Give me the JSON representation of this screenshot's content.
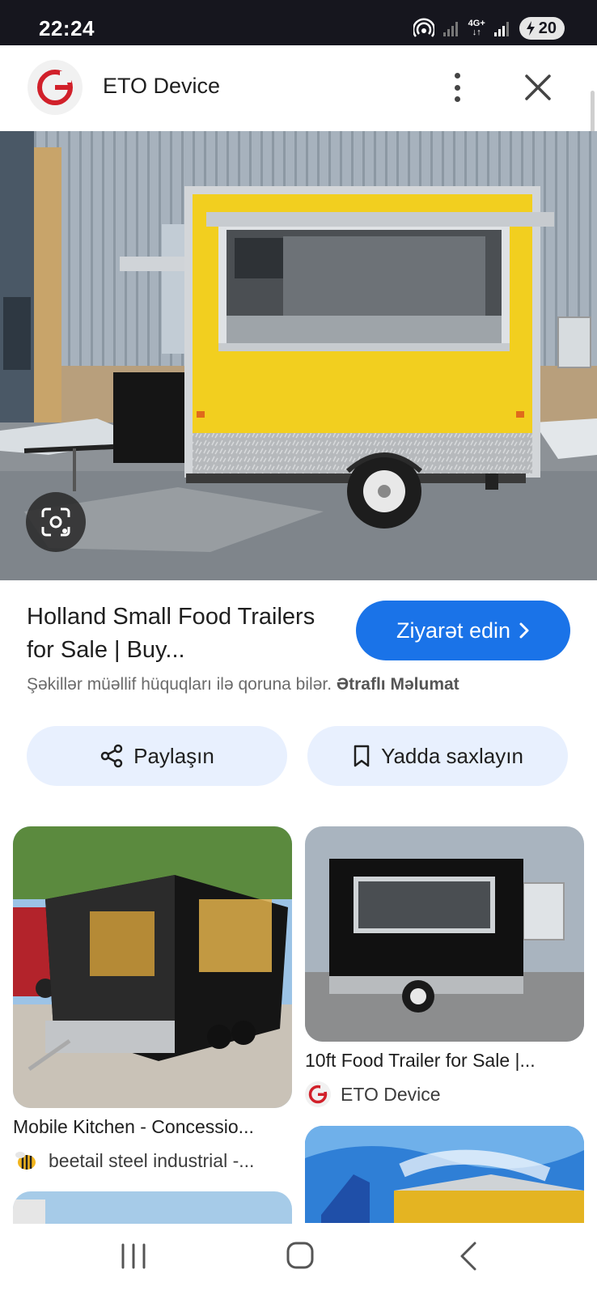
{
  "status_bar": {
    "time": "22:24",
    "network": "4G+",
    "battery": "20",
    "icons": [
      "hotspot-icon",
      "signal-icon",
      "signal-icon",
      "battery-icon"
    ]
  },
  "header": {
    "site_name": "ETO Device",
    "logo_letter": "G",
    "icons": [
      "more-options-icon",
      "close-icon"
    ]
  },
  "result": {
    "title": "Holland Small Food Trailers for Sale | Buy...",
    "visit_label": "Ziyarət edin",
    "copyright_text": "Şəkillər müəllif hüquqları ilə qoruna bilər.",
    "more_info_label": "Ətraflı Məlumat",
    "share_label": "Paylaşın",
    "save_label": "Yadda saxlayın",
    "lens_icon": "lens-search-icon"
  },
  "related": [
    {
      "caption": "Mobile Kitchen - Concessio...",
      "source": "beetail steel industrial -..."
    },
    {
      "caption": "10ft Food Trailer for Sale |...",
      "source": "ETO Device"
    }
  ],
  "colors": {
    "accent": "#1a73e8",
    "pill_bg": "#e8f0fe",
    "trailer_yellow": "#f2cf1f",
    "status_bar": "#16161e"
  },
  "nav_icons": [
    "recent-apps-icon",
    "home-icon",
    "back-icon"
  ]
}
